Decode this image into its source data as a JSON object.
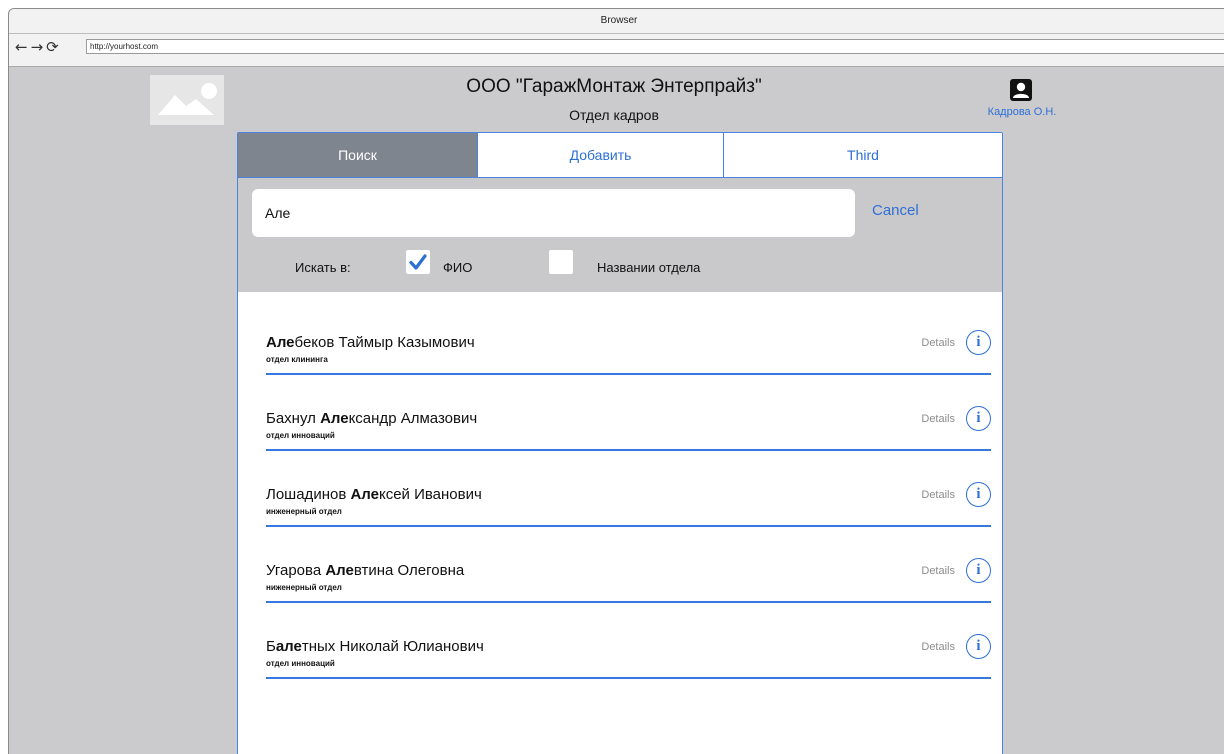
{
  "browser": {
    "title": "Browser",
    "back": "←",
    "forward": "→",
    "reload": "⟳",
    "url": "http://yourhost.com"
  },
  "header": {
    "company": "ООО \"ГаражМонтаж Энтерпрайз\"",
    "department": "Отдел кадров",
    "user_name": "Кадрова О.Н.",
    "logo_icon": "image-placeholder-icon",
    "user_icon": "user-icon"
  },
  "tabs": [
    {
      "label": "Поиск",
      "active": true
    },
    {
      "label": "Добавить",
      "active": false
    },
    {
      "label": "Third",
      "active": false
    }
  ],
  "search": {
    "value": "Але",
    "placeholder": "",
    "cancel_label": "Cancel",
    "search_in_label": "Искать в:",
    "options": [
      {
        "label": "ФИО",
        "checked": true
      },
      {
        "label": "Названии отдела",
        "checked": false
      }
    ]
  },
  "results": [
    {
      "pre": "",
      "match": "Але",
      "post": "беков Таймыр Казымович",
      "dept": "отдел клининга",
      "details": "Details"
    },
    {
      "pre": "Бахнул ",
      "match": "Але",
      "post": "ксандр Алмазович",
      "dept": "отдел инноваций",
      "details": "Details"
    },
    {
      "pre": "Лошадинов ",
      "match": "Але",
      "post": "ксей Иванович",
      "dept": "инженерный отдел",
      "details": "Details"
    },
    {
      "pre": "Угарова ",
      "match": "Але",
      "post": "втина Олеговна",
      "dept": "ниженерный отдел",
      "details": "Details"
    },
    {
      "pre": "Б",
      "match": "але",
      "post": "тных Николай Юлианович",
      "dept": "отдел инноваций",
      "details": "Details"
    }
  ],
  "colors": {
    "accent": "#2e6fd6",
    "active_tab": "#7f858e",
    "background": "#cbcbce"
  }
}
